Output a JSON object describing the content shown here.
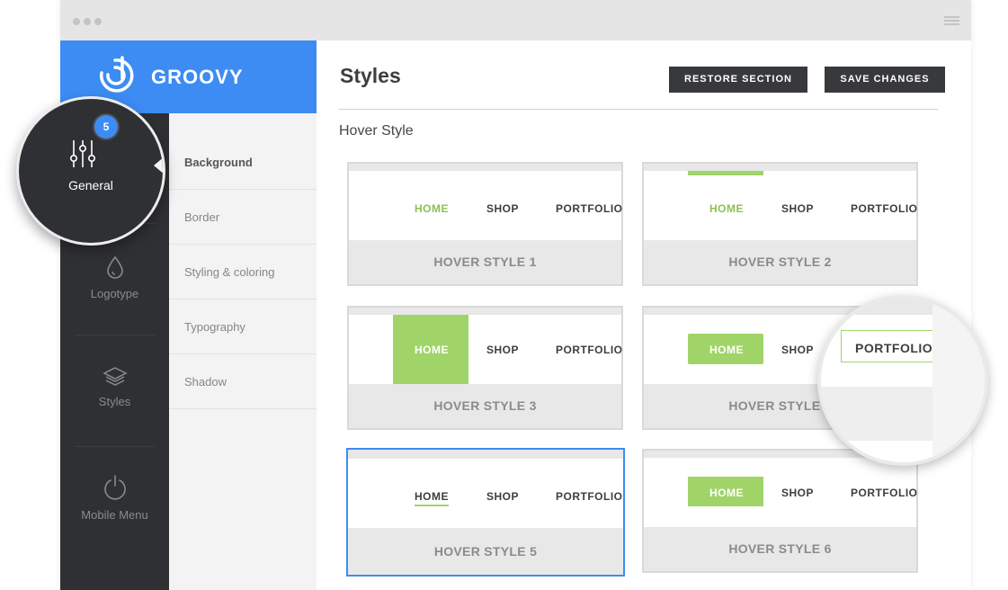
{
  "brand": {
    "name": "GROOVY"
  },
  "rail": {
    "items": [
      {
        "label": "General",
        "icon": "sliders-icon",
        "badge": "5"
      },
      {
        "label": "Logotype",
        "icon": "drop-icon"
      },
      {
        "label": "Styles",
        "icon": "layers-icon"
      },
      {
        "label": "Mobile Menu",
        "icon": "power-icon"
      }
    ]
  },
  "submenu": {
    "items": [
      {
        "label": "Background",
        "active": true
      },
      {
        "label": "Border"
      },
      {
        "label": "Styling & coloring"
      },
      {
        "label": "Typography"
      },
      {
        "label": "Shadow"
      }
    ]
  },
  "content": {
    "title": "Styles",
    "restore_label": "RESTORE SECTION",
    "save_label": "SAVE CHANGES",
    "section_label": "Hover Style"
  },
  "nav_labels": {
    "home": "HOME",
    "shop": "SHOP",
    "portfolio": "PORTFOLIO"
  },
  "cards": [
    {
      "caption": "HOVER STYLE 1"
    },
    {
      "caption": "HOVER STYLE 2"
    },
    {
      "caption": "HOVER STYLE 3"
    },
    {
      "caption": "HOVER STYLE 4"
    },
    {
      "caption": "HOVER STYLE 5",
      "selected": true
    },
    {
      "caption": "HOVER STYLE 6"
    }
  ],
  "colors": {
    "accent": "#3d8cf3",
    "green": "#a0d468",
    "dark": "#2f3033"
  }
}
